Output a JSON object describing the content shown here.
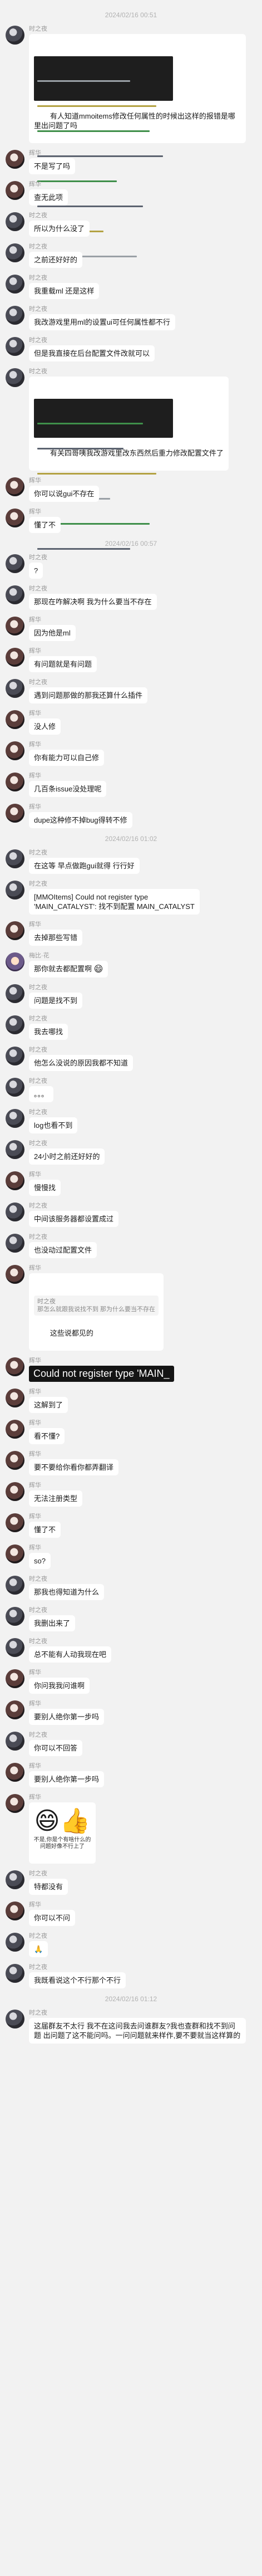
{
  "chat": {
    "sender_a": "时之夜",
    "sender_b": "辉华",
    "sender_c": "梅比·花",
    "timestamps": [
      "2024/02/16 00:51",
      "2024/02/16 00:57",
      "2024/02/16 01:02",
      "2024/02/16 01:12"
    ],
    "messages": [
      {
        "text": "有人知道mmoitems修改任何属性的时候出这样的报错是哪里出问题了吗"
      },
      {
        "text": "不是写了吗"
      },
      {
        "text": "查无此项"
      },
      {
        "text": "所以为什么没了"
      },
      {
        "text": "之前还好好的"
      },
      {
        "text": "我重载ml 还是这样"
      },
      {
        "text": "我改游戏里用ml的设置ui可任何属性都不行"
      },
      {
        "text": "但是我直接在后台配置文件改就可以"
      },
      {
        "text": "有关四哥咦我改游戏里改东西然后重力修改配置文件了"
      },
      {
        "text": "你可以说gui不存在"
      },
      {
        "text": "懂了不"
      },
      {
        "text": "?"
      },
      {
        "text": "那现在咋解决啊 我为什么要当不存在"
      },
      {
        "text": "因为他是ml"
      },
      {
        "text": "有问题就是有问题"
      },
      {
        "text": "遇到问题那做的那我还算什么插件"
      },
      {
        "text": "没人修"
      },
      {
        "text": "你有能力可以自己修"
      },
      {
        "text": "几百条issue没处理呢"
      },
      {
        "text": "dupe这种修不掉bug得转不修"
      },
      {
        "text": "在这等 早点做跑gui就得 行行好"
      },
      {
        "text": "[MMOItems] Could not register type\n'MAIN_CATALYST': 找不到配置 MAIN_CATALYST"
      },
      {
        "text": "去掉那些写错"
      },
      {
        "text": "那你就去都配置啊"
      },
      {
        "text": "问题是找不到"
      },
      {
        "text": "我去哪找"
      },
      {
        "text": "他怎么没说的原因我都不知道"
      },
      {
        "text": "。。。"
      },
      {
        "text": "log也看不到"
      },
      {
        "text": "24小时之前还好好的"
      },
      {
        "text": "慢慢找"
      },
      {
        "text": "中间该服务器都设置成过"
      },
      {
        "text": "也没动过配置文件"
      },
      {
        "quote": "时之夜\n那怎么就跟我说找不到 那为什么要当不存在",
        "text": "这些说都见的"
      },
      {
        "text": "Could not register type 'MAIN_"
      },
      {
        "text": "这解到了"
      },
      {
        "text": "看不懂?"
      },
      {
        "text": "要不要给你看你都弄翻译"
      },
      {
        "text": "无法注册类型"
      },
      {
        "text": "懂了不"
      },
      {
        "text": "so?"
      },
      {
        "text": "那我也得知道为什么"
      },
      {
        "text": "我删出来了"
      },
      {
        "text": "总不能有人动我现在吧"
      },
      {
        "text": "你问我我问谁啊"
      },
      {
        "text": "要别人绝你第一步吗"
      },
      {
        "text": "你可以不回答"
      },
      {
        "text": "要别人绝你第一步吗"
      },
      {
        "sticker_caption": "不是,你是个有啥什么的问题好像不行上了",
        "sticker": "thumbs-up-face"
      },
      {
        "text": "特都没有"
      },
      {
        "text": "你可以不问"
      },
      {
        "text": "🙏"
      },
      {
        "text": "我既看说这个不行那个不行"
      },
      {
        "text": "这届群友不太行 我不在这问我去问谁群友?我也查群和找不到问题 出问题了这不能问吗。一问问题就来样作,要不要就当这样算的"
      }
    ]
  },
  "colors": {
    "background": "#f2f2f2",
    "bubble": "#ffffff",
    "name": "#999999",
    "timestamp": "#b2b2b2"
  }
}
